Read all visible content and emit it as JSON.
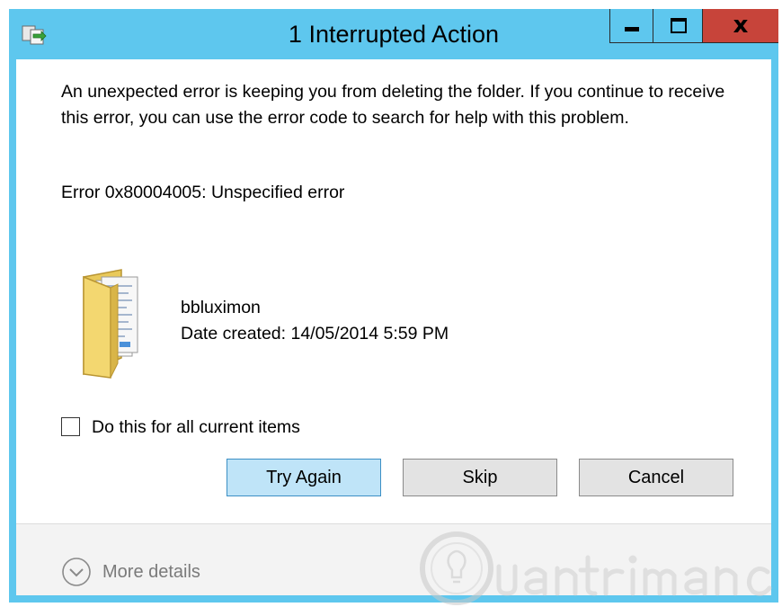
{
  "window": {
    "title": "1 Interrupted Action",
    "controls": {
      "minimize": "minimize",
      "maximize": "maximize",
      "close": "x"
    }
  },
  "dialog": {
    "message": "An unexpected error is keeping you from deleting the folder. If you continue to receive this error, you can use the error code to search for help with this problem.",
    "error_code": "Error 0x80004005: Unspecified error",
    "item": {
      "icon": "folder-icon",
      "name": "bbluximon",
      "date_created": "Date created: 14/05/2014 5:59 PM"
    },
    "checkbox": {
      "label": "Do this for all current items",
      "checked": false
    },
    "buttons": {
      "try_again": "Try Again",
      "skip": "Skip",
      "cancel": "Cancel"
    },
    "more_details": "More details"
  },
  "colors": {
    "titlebar": "#5ec7ee",
    "close_button": "#c7443a",
    "primary_button": "#bfe4f8",
    "footer": "#f3f3f3"
  }
}
